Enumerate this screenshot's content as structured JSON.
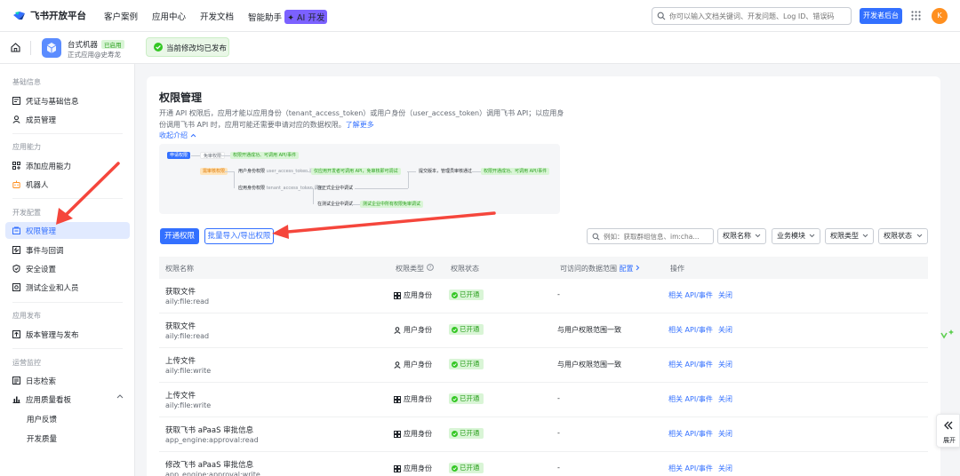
{
  "topbar": {
    "logo_text": "飞书开放平台",
    "nav": [
      "客户案例",
      "应用中心",
      "开发文档",
      "智能助手"
    ],
    "ai_badge": "✦ AI 开发",
    "search_placeholder": "你可以输入文档关键词、开发问题、Log ID、错误码",
    "dev_console": "开发者后台",
    "avatar_letter": "K"
  },
  "app": {
    "name": "台式机器",
    "tag": "已启用",
    "sub": "正式应用@史寿龙"
  },
  "toast": "当前修改均已发布",
  "sidebar": {
    "sections": [
      {
        "title": "基础信息",
        "items": [
          "凭证与基础信息",
          "成员管理"
        ]
      },
      {
        "title": "应用能力",
        "items": [
          "添加应用能力",
          "机器人"
        ]
      },
      {
        "title": "开发配置",
        "items": [
          "权限管理",
          "事件与回调",
          "安全设置",
          "测试企业和人员"
        ]
      },
      {
        "title": "应用发布",
        "items": [
          "版本管理与发布"
        ]
      },
      {
        "title": "运营监控",
        "items": [
          "日志检索",
          "应用质量看板"
        ]
      }
    ],
    "subitems": [
      "用户反馈",
      "开发质量"
    ],
    "active": "权限管理"
  },
  "main": {
    "title": "权限管理",
    "desc_text": "开通 API 权限后，应用才能以应用身份（tenant_access_token）或用户身份（user_access_token）调用飞书 API；以应用身份调用飞书 API 时，应用可能还需要申请对应的数据权限。",
    "learn_more": "了解更多",
    "collapse": "收起介绍"
  },
  "flow": {
    "start": "申请权限",
    "app_perm": "免审权限",
    "app_perm_result": "权限开通成功、可调用 API/事件",
    "review_perm": "需审核权限",
    "user_identity": "用户身份权限",
    "user_token": "user_access_token 调用",
    "dev_test": "仅应用开发者可调用 API，免审核即可调试",
    "submit": "提交版本，管理员审核通过",
    "result": "权限开通成功、可调用 API/事件",
    "app_identity": "应用身份权限",
    "tenant_token": "tenant_access_token 调用",
    "in_tenant": "在正式企业中调试",
    "in_test": "在测试企业中调试",
    "test_result": "测试企业中所有权限免审调试"
  },
  "toolbar": {
    "enable": "开通权限",
    "batch": "批量导入/导出权限",
    "search_placeholder": "例如：获取群组信息、im:cha...",
    "filters": [
      "权限名称",
      "业务模块",
      "权限类型",
      "权限状态"
    ]
  },
  "table": {
    "headers": {
      "name": "权限名称",
      "type": "权限类型",
      "status": "权限状态",
      "scope": "可访问的数据范围",
      "scope_link": "配置",
      "action": "操作"
    },
    "rows": [
      {
        "name": "获取文件",
        "key": "aily:file:read",
        "type": "应用身份",
        "status": "已开通",
        "scope": "-",
        "api": "相关 API/事件",
        "close": "关闭"
      },
      {
        "name": "获取文件",
        "key": "aily:file:read",
        "type": "用户身份",
        "status": "已开通",
        "scope": "与用户权限范围一致",
        "api": "相关 API/事件",
        "close": "关闭"
      },
      {
        "name": "上传文件",
        "key": "aily:file:write",
        "type": "用户身份",
        "status": "已开通",
        "scope": "与用户权限范围一致",
        "api": "相关 API/事件",
        "close": "关闭"
      },
      {
        "name": "上传文件",
        "key": "aily:file:write",
        "type": "应用身份",
        "status": "已开通",
        "scope": "-",
        "api": "相关 API/事件",
        "close": "关闭"
      },
      {
        "name": "获取飞书 aPaaS 审批信息",
        "key": "app_engine:approval:read",
        "type": "应用身份",
        "status": "已开通",
        "scope": "-",
        "api": "相关 API/事件",
        "close": "关闭"
      },
      {
        "name": "修改飞书 aPaaS 审批信息",
        "key": "app_engine:approval:write",
        "type": "应用身份",
        "status": "已开通",
        "scope": "-",
        "api": "相关 API/事件",
        "close": "关闭"
      }
    ]
  },
  "expand": "展开",
  "colors": {
    "accent": "#3370ff",
    "success": "#2ea121",
    "arrow": "#f5463c"
  }
}
